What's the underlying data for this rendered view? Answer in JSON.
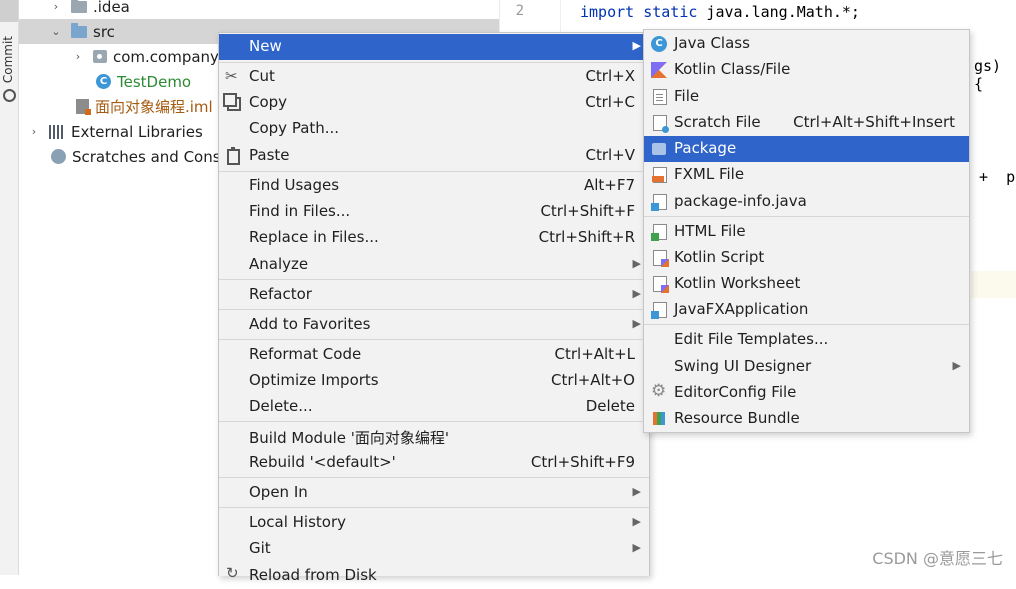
{
  "sidebar": {
    "commit_label": "Commit"
  },
  "tree": {
    "rows": [
      {
        "label": ".idea"
      },
      {
        "label": "src"
      },
      {
        "label": "com.company"
      },
      {
        "label": "TestDemo"
      },
      {
        "label": "面向对象编程.iml"
      },
      {
        "label": "External Libraries"
      },
      {
        "label": "Scratches and Consoles"
      }
    ]
  },
  "editor": {
    "line_number": "2",
    "line1_kw1": "import",
    "line1_kw2": "static",
    "line1_rest": " java.lang.Math.*;",
    "fragment_args": "gs) {",
    "fragment_plus": "+  p"
  },
  "context_menu": {
    "items": [
      {
        "label": "New",
        "shortcut": ""
      },
      {
        "label": "Cut",
        "shortcut": "Ctrl+X"
      },
      {
        "label": "Copy",
        "shortcut": "Ctrl+C"
      },
      {
        "label": "Copy Path...",
        "shortcut": ""
      },
      {
        "label": "Paste",
        "shortcut": "Ctrl+V"
      },
      {
        "label": "Find Usages",
        "shortcut": "Alt+F7"
      },
      {
        "label": "Find in Files...",
        "shortcut": "Ctrl+Shift+F"
      },
      {
        "label": "Replace in Files...",
        "shortcut": "Ctrl+Shift+R"
      },
      {
        "label": "Analyze",
        "shortcut": ""
      },
      {
        "label": "Refactor",
        "shortcut": ""
      },
      {
        "label": "Add to Favorites",
        "shortcut": ""
      },
      {
        "label": "Reformat Code",
        "shortcut": "Ctrl+Alt+L"
      },
      {
        "label": "Optimize Imports",
        "shortcut": "Ctrl+Alt+O"
      },
      {
        "label": "Delete...",
        "shortcut": "Delete"
      },
      {
        "label": "Build Module '面向对象编程'",
        "shortcut": ""
      },
      {
        "label": "Rebuild '<default>'",
        "shortcut": "Ctrl+Shift+F9"
      },
      {
        "label": "Open In",
        "shortcut": ""
      },
      {
        "label": "Local History",
        "shortcut": ""
      },
      {
        "label": "Git",
        "shortcut": ""
      },
      {
        "label": "Reload from Disk",
        "shortcut": ""
      }
    ]
  },
  "new_submenu": {
    "items": [
      {
        "label": "Java Class",
        "shortcut": ""
      },
      {
        "label": "Kotlin Class/File",
        "shortcut": ""
      },
      {
        "label": "File",
        "shortcut": ""
      },
      {
        "label": "Scratch File",
        "shortcut": "Ctrl+Alt+Shift+Insert"
      },
      {
        "label": "Package",
        "shortcut": ""
      },
      {
        "label": "FXML File",
        "shortcut": ""
      },
      {
        "label": "package-info.java",
        "shortcut": ""
      },
      {
        "label": "HTML File",
        "shortcut": ""
      },
      {
        "label": "Kotlin Script",
        "shortcut": ""
      },
      {
        "label": "Kotlin Worksheet",
        "shortcut": ""
      },
      {
        "label": "JavaFXApplication",
        "shortcut": ""
      },
      {
        "label": "Edit File Templates...",
        "shortcut": ""
      },
      {
        "label": "Swing UI Designer",
        "shortcut": ""
      },
      {
        "label": "EditorConfig File",
        "shortcut": ""
      },
      {
        "label": "Resource Bundle",
        "shortcut": ""
      }
    ]
  },
  "watermark": "CSDN @意愿三七",
  "colors": {
    "highlight": "#2f65ca",
    "menu_bg": "#f2f2f2",
    "keyword": "#0033b3"
  },
  "icons": {
    "arrow_collapsed": "▸",
    "arrow_expanded": "▾",
    "submenu_arrow": "▶"
  }
}
